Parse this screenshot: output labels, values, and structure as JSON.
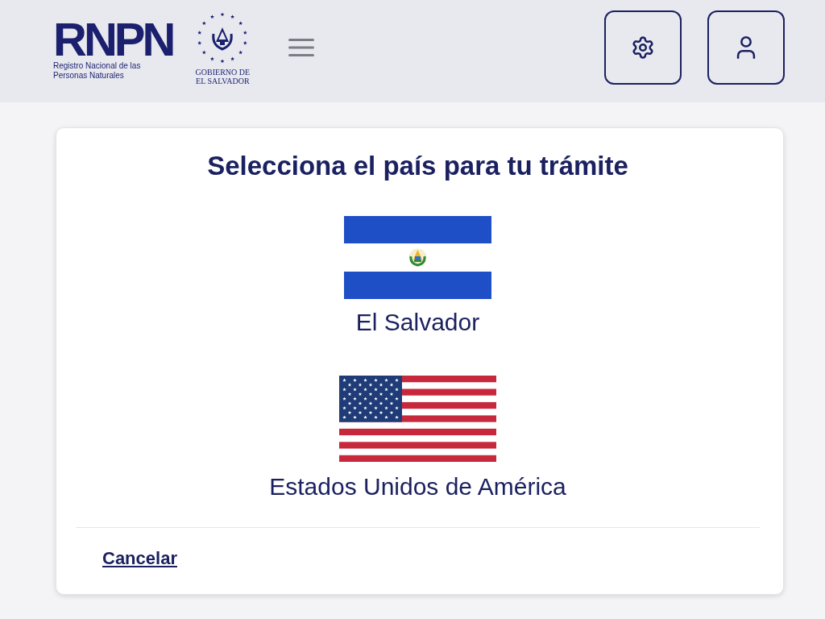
{
  "header": {
    "logo": {
      "acronym": "RNPN",
      "subtitle": "Registro Nacional de las Personas Naturales"
    },
    "government_seal": {
      "label": "GOBIERNO DE EL SALVADOR"
    }
  },
  "dialog": {
    "title": "Selecciona el país para tu trámite",
    "countries": [
      {
        "name": "El Salvador",
        "kind": "sv"
      },
      {
        "name": "Estados Unidos de América",
        "kind": "us"
      }
    ],
    "cancel_link": "Cancelar"
  }
}
